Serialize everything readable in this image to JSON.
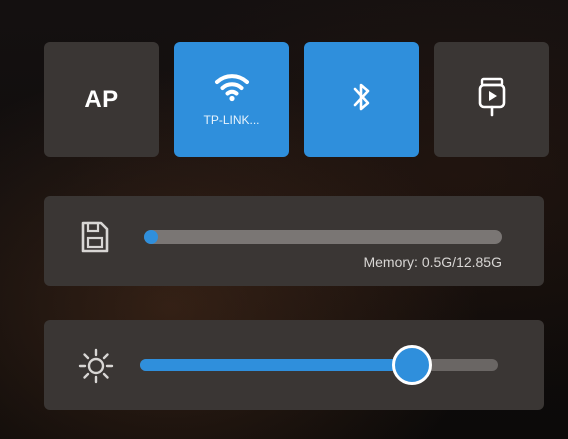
{
  "tiles": {
    "ap": {
      "label": "AP",
      "active": false
    },
    "wifi": {
      "ssid": "TP-LINK...",
      "active": true,
      "icon": "wifi-icon"
    },
    "bluetooth": {
      "active": true,
      "icon": "bluetooth-icon"
    },
    "camera_stream": {
      "active": false,
      "icon": "camera-stream-icon"
    }
  },
  "memory": {
    "label": "Memory: 0.5G/12.85G",
    "used_fraction": 0.039,
    "icon": "sd-card-icon"
  },
  "brightness": {
    "level": 0.76,
    "icon": "sun-icon"
  },
  "colors": {
    "accent": "#2f8fdc",
    "tile": "#3a3634"
  }
}
